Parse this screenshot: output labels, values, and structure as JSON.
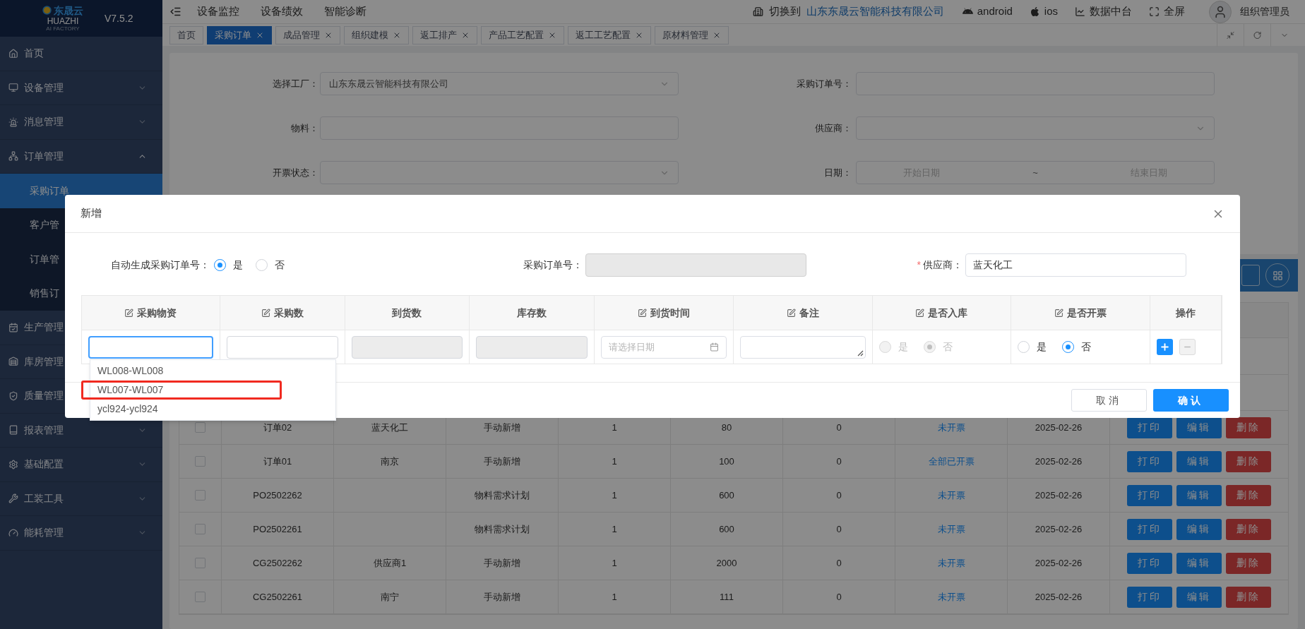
{
  "logo": {
    "brand": "东晟云",
    "name": "HUAZHI",
    "tagline": "AI FACTORY",
    "version": "V7.5.2"
  },
  "sidebar": {
    "items": [
      {
        "label": "首页",
        "selected": false
      },
      {
        "label": "设备管理",
        "selected": false,
        "expanded": false
      },
      {
        "label": "消息管理",
        "selected": false,
        "expanded": false
      },
      {
        "label": "订单管理",
        "selected": false,
        "expanded": true,
        "children": [
          {
            "label": "采购订单",
            "selected": true
          },
          {
            "label": "客户管",
            "selected": false
          },
          {
            "label": "订单管",
            "selected": false
          },
          {
            "label": "销售订",
            "selected": false
          }
        ]
      },
      {
        "label": "生产管理",
        "selected": false
      },
      {
        "label": "库房管理",
        "selected": false
      },
      {
        "label": "质量管理",
        "selected": false
      },
      {
        "label": "报表管理",
        "selected": false,
        "expanded": false
      },
      {
        "label": "基础配置",
        "selected": false,
        "expanded": false
      },
      {
        "label": "工装工具",
        "selected": false,
        "expanded": false
      },
      {
        "label": "能耗管理",
        "selected": false,
        "expanded": false
      }
    ]
  },
  "topbar": {
    "nav": [
      "设备监控",
      "设备绩效",
      "智能诊断"
    ],
    "switch_label": "切换到",
    "company": "山东东晟云智能科技有限公司",
    "links": [
      "android",
      "ios",
      "数据中台",
      "全屏"
    ],
    "user": "组织管理员"
  },
  "tabs": [
    {
      "label": "首页",
      "selected": false,
      "closable": false
    },
    {
      "label": "采购订单",
      "selected": true,
      "closable": true
    },
    {
      "label": "成品管理",
      "selected": false,
      "closable": true
    },
    {
      "label": "组织建模",
      "selected": false,
      "closable": true
    },
    {
      "label": "返工排产",
      "selected": false,
      "closable": true
    },
    {
      "label": "产品工艺配置",
      "selected": false,
      "closable": true
    },
    {
      "label": "返工工艺配置",
      "selected": false,
      "closable": true
    },
    {
      "label": "原材料管理",
      "selected": false,
      "closable": true
    }
  ],
  "filters": [
    {
      "label": "选择工厂：",
      "kind": "select",
      "value": "山东东晟云智能科技有限公司"
    },
    {
      "label": "采购订单号：",
      "kind": "input"
    },
    {
      "label": "物料：",
      "kind": "input"
    },
    {
      "label": "供应商：",
      "kind": "select"
    },
    {
      "label": "开票状态：",
      "kind": "select"
    },
    {
      "label": "日期：",
      "kind": "daterange",
      "start_placeholder": "开始日期",
      "separator": "~",
      "end_placeholder": "结束日期"
    }
  ],
  "table": {
    "rows": [
      {
        "checked": false,
        "cells": [
          "订单02",
          "蓝天化工",
          "手动新增",
          "1",
          "80",
          "0",
          "未开票",
          "2025-02-26"
        ],
        "actions": [
          "打印",
          "编辑",
          "删除"
        ]
      },
      {
        "checked": false,
        "cells": [
          "订单01",
          "南京",
          "手动新增",
          "1",
          "100",
          "0",
          "全部已开票",
          "2025-02-26"
        ],
        "actions": [
          "打印",
          "编辑",
          "删除"
        ]
      },
      {
        "checked": false,
        "cells": [
          "PO2502262",
          null,
          "物料需求计划",
          "1",
          "600",
          "0",
          "未开票",
          "2025-02-26"
        ],
        "actions": [
          "打印",
          "编辑",
          "删除"
        ]
      },
      {
        "checked": false,
        "cells": [
          "PO2502261",
          null,
          "物料需求计划",
          "1",
          "600",
          "0",
          "未开票",
          "2025-02-26"
        ],
        "actions": [
          "打印",
          "编辑",
          "删除"
        ]
      },
      {
        "checked": false,
        "cells": [
          "CG2502262",
          "供应商1",
          "手动新增",
          "1",
          "2000",
          "0",
          "未开票",
          "2025-02-26"
        ],
        "actions": [
          "打印",
          "编辑",
          "删除"
        ]
      },
      {
        "checked": false,
        "cells": [
          "CG2502261",
          "南宁",
          "手动新增",
          "1",
          "111",
          "0",
          "未开票",
          "2025-02-26"
        ],
        "actions": [
          "打印",
          "编辑",
          "删除"
        ]
      }
    ]
  },
  "modal": {
    "title": "新增",
    "auto_number": {
      "label": "自动生成采购订单号：",
      "options": [
        {
          "label": "是",
          "selected": true
        },
        {
          "label": "否",
          "selected": false
        }
      ]
    },
    "order_no": {
      "label": "采购订单号：",
      "disabled": true
    },
    "supplier": {
      "label": "供应商：",
      "required": true,
      "required_mark": "*",
      "value": "蓝天化工"
    },
    "grid": {
      "columns": [
        {
          "label": "采购物资",
          "editable": true
        },
        {
          "label": "采购数",
          "editable": true
        },
        {
          "label": "到货数",
          "editable": false
        },
        {
          "label": "库存数",
          "editable": false
        },
        {
          "label": "到货时间",
          "editable": true
        },
        {
          "label": "备注",
          "editable": true
        },
        {
          "label": "是否入库",
          "editable": true
        },
        {
          "label": "是否开票",
          "editable": true
        },
        {
          "label": "操作",
          "editable": false
        }
      ],
      "cells": [
        {
          "kind": "input",
          "focused": true,
          "disabled": false
        },
        {
          "kind": "input",
          "focused": false,
          "disabled": false
        },
        {
          "kind": "input",
          "focused": false,
          "disabled": true
        },
        {
          "kind": "input",
          "focused": false,
          "disabled": true
        },
        {
          "kind": "date",
          "placeholder": "请选择日期"
        },
        {
          "kind": "textarea"
        },
        {
          "kind": "radio",
          "disabled": true,
          "options": [
            {
              "label": "是",
              "selected": false
            },
            {
              "label": "否",
              "selected": true
            }
          ]
        },
        {
          "kind": "radio",
          "disabled": false,
          "options": [
            {
              "label": "是",
              "selected": false
            },
            {
              "label": "否",
              "selected": true
            }
          ]
        },
        {
          "kind": "actions",
          "remove_disabled": true
        }
      ]
    },
    "dropdown": {
      "options": [
        {
          "label": "WL008-WL008",
          "highlighted": false
        },
        {
          "label": "WL007-WL007",
          "highlighted": true
        },
        {
          "label": "ycl924-ycl924",
          "highlighted": false
        }
      ]
    },
    "buttons": [
      {
        "label": "取消",
        "kind": "secondary"
      },
      {
        "label": "确认",
        "kind": "primary"
      }
    ]
  }
}
